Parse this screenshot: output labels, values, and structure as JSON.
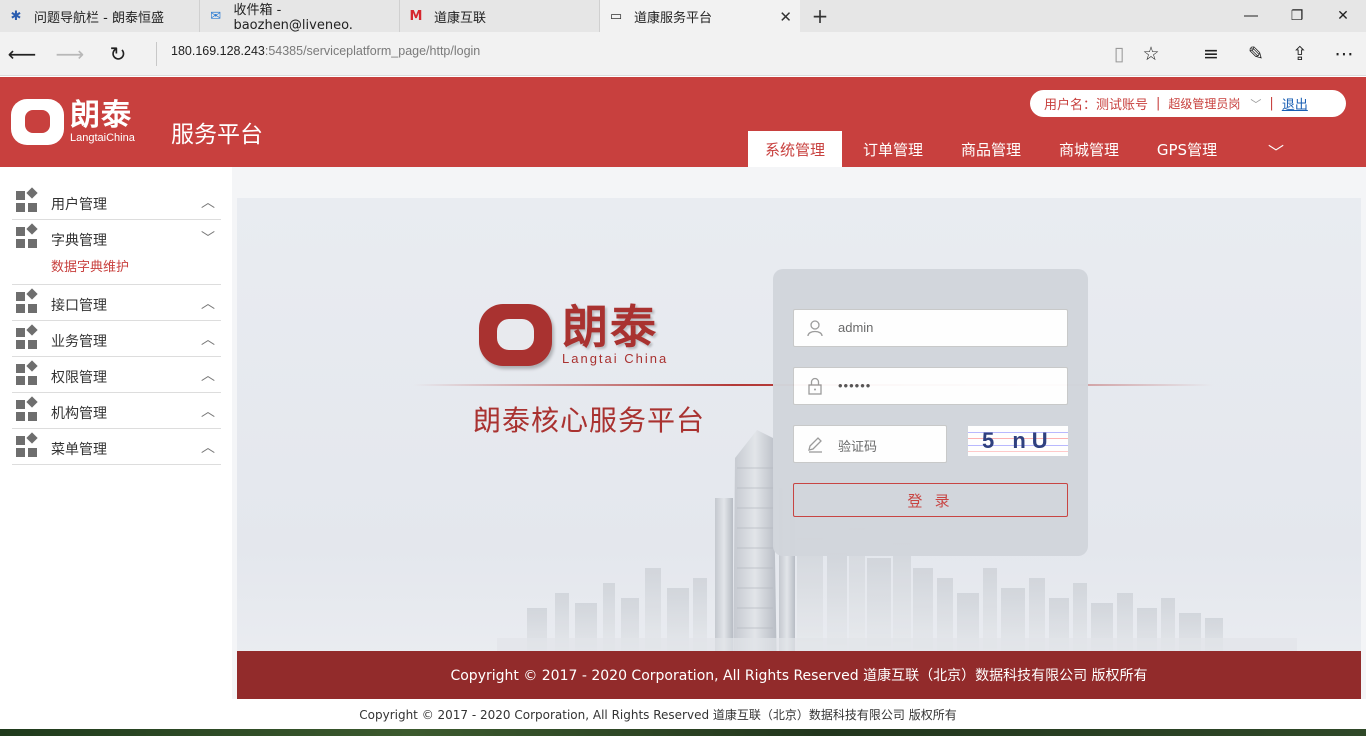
{
  "browser": {
    "tabs": [
      {
        "title": "问题导航栏 - 朗泰恒盛",
        "icon": "bug-icon"
      },
      {
        "title": "收件箱 - baozhen@liveneo.",
        "icon": "mail-icon"
      },
      {
        "title": "道康互联",
        "icon": "m-logo-icon"
      },
      {
        "title": "道康服务平台",
        "icon": "page-icon"
      }
    ],
    "url_host": "180.169.128.243",
    "url_rest": ":54385/serviceplatform_page/http/login"
  },
  "header": {
    "logo_cn": "朗泰",
    "logo_en": "LangtaiChina",
    "app_name": "服务平台",
    "user_label": "用户名：测试账号",
    "user_sep": "|",
    "role": "超级管理员岗",
    "logout": "退出",
    "nav": [
      "系统管理",
      "订单管理",
      "商品管理",
      "商城管理",
      "GPS管理"
    ],
    "brand_color": "#c8403e"
  },
  "sidebar": {
    "items": [
      {
        "label": "用户管理",
        "expanded": false
      },
      {
        "label": "字典管理",
        "expanded": true
      },
      {
        "label": "接口管理",
        "expanded": false
      },
      {
        "label": "业务管理",
        "expanded": false
      },
      {
        "label": "权限管理",
        "expanded": false
      },
      {
        "label": "机构管理",
        "expanded": false
      },
      {
        "label": "菜单管理",
        "expanded": false
      }
    ],
    "submenu": "数据字典维护"
  },
  "login": {
    "brand_cn": "朗泰",
    "brand_en": "Langtai China",
    "platform_title": "朗泰核心服务平台",
    "username": "admin",
    "password": "••••••",
    "captcha_placeholder": "验证码",
    "captcha_text": "5 nU",
    "button": "登 录"
  },
  "footer": {
    "copyright": "Copyright © 2017 - 2020 Corporation, All Rights Reserved 道康互联（北京）数据科技有限公司 版权所有",
    "page_copyright": "Copyright © 2017 - 2020 Corporation, All Rights Reserved 道康互联（北京）数据科技有限公司 版权所有"
  }
}
